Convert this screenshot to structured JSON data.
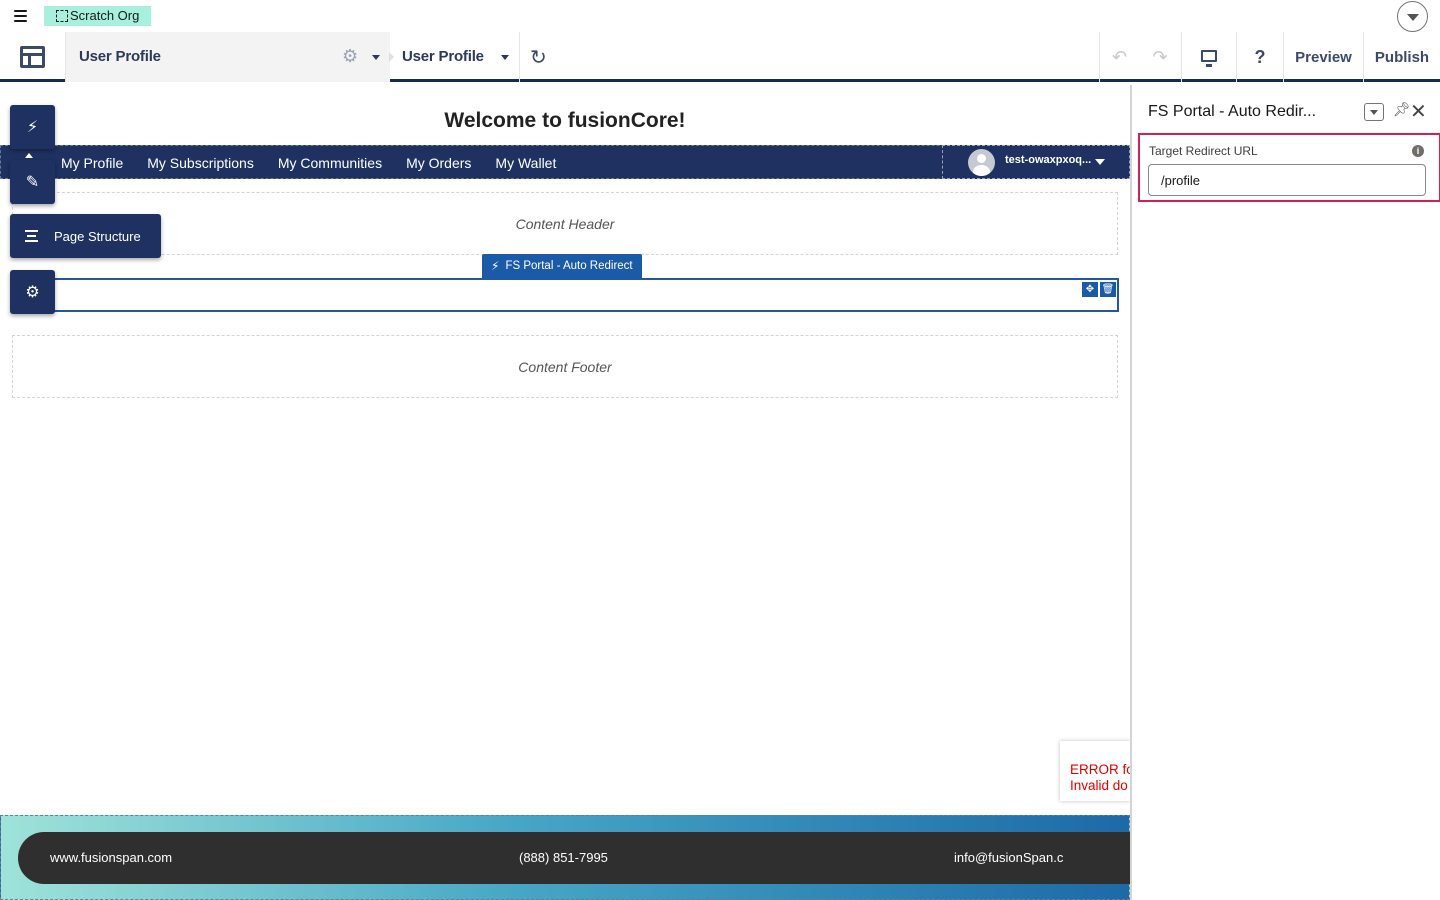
{
  "global_header": {
    "org_badge": "Scratch Org",
    "menu_icon": "hamburger-icon",
    "setup_icon": "chevron-down-icon"
  },
  "toolbar": {
    "page_name": "User Profile",
    "variation_name": "User Profile",
    "preview_label": "Preview",
    "publish_label": "Publish",
    "help_label": "?"
  },
  "canvas": {
    "welcome_title": "Welcome to fusionCore!",
    "nav_items": [
      "My Profile",
      "My Subscriptions",
      "My Communities",
      "My Orders",
      "My Wallet"
    ],
    "user_name": "test-owaxpxoq...",
    "content_header": "Content Header",
    "content_footer": "Content Footer",
    "selected_component": "FS Portal - Auto Redirect",
    "tools": {
      "page_structure_label": "Page Structure"
    },
    "footer": {
      "website": "www.fusionspan.com",
      "phone": "(888) 851-7995",
      "email": "info@fusionSpan.c"
    },
    "error_text": {
      "line1": "ERROR fo",
      "line2": "Invalid do"
    }
  },
  "property_panel": {
    "title": "FS Portal - Auto Redir...",
    "field_label": "Target Redirect URL",
    "field_value": "/profile"
  },
  "colors": {
    "nav_bg": "#1e3160",
    "selection_blue": "#1b5aa6",
    "highlight_red": "#d02250",
    "org_badge_bg": "#a8f0de"
  }
}
